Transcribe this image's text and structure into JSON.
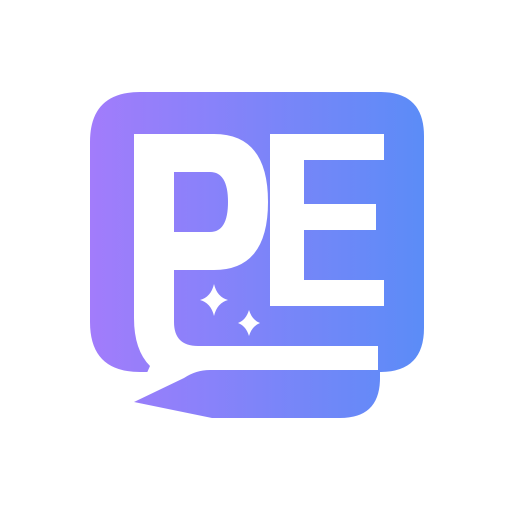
{
  "logo": {
    "text": "PE",
    "description_icon": "sparkle-icon",
    "colors": {
      "gradient_start": "#a27cfb",
      "gradient_end": "#5b8cf7",
      "foreground": "#ffffff",
      "background": "#ffffff"
    }
  }
}
